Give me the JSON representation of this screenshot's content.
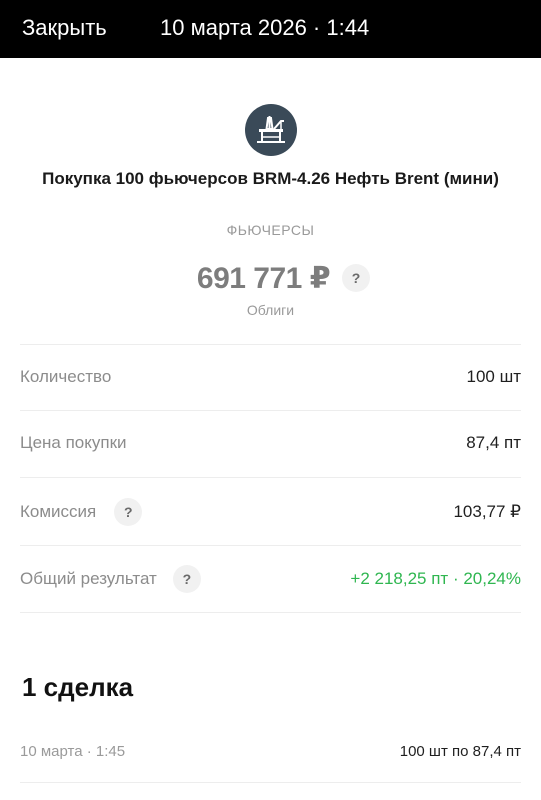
{
  "topbar": {
    "close_label": "Закрыть",
    "datetime": "10 марта 2026 · 1:44"
  },
  "header": {
    "logo_icon": "oil-platform-icon",
    "title": "Покупка 100 фьючерсов BRM-4.26 Нефть Brent (мини)",
    "category": "ФЬЮЧЕРСЫ",
    "amount": "691 771 ₽",
    "amount_help": "?",
    "amount_subtitle": "Облиги"
  },
  "details": [
    {
      "label": "Количество",
      "value": "100 шт",
      "help": ""
    },
    {
      "label": "Цена покупки",
      "value": "87,4 пт",
      "help": ""
    },
    {
      "label": "Комиссия",
      "value": "103,77 ₽",
      "help": "?"
    },
    {
      "label": "Общий результат",
      "value": "+2 218,25 пт · 20,24%",
      "help": "?"
    }
  ],
  "deals": {
    "title": "1 сделка",
    "items": [
      {
        "date": "10 марта · 1:45",
        "value": "100 шт по 87,4 пт"
      }
    ]
  },
  "colors": {
    "positive": "#2fb650",
    "logo_bg": "#3a4a58",
    "topbar_bg": "#000000"
  }
}
